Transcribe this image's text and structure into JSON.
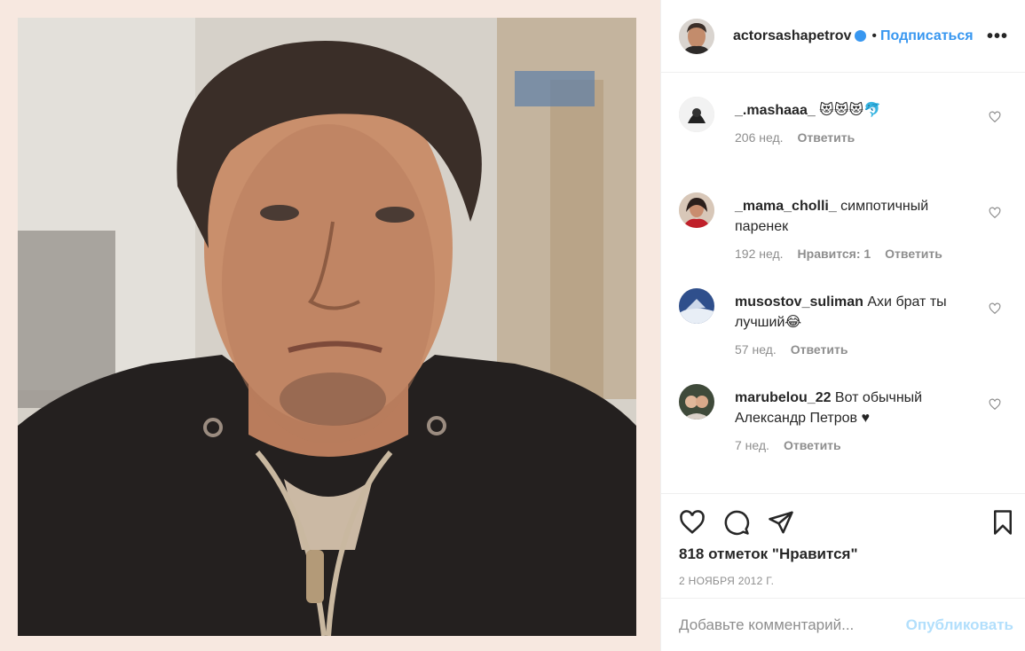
{
  "post": {
    "author": "actorsashapetrov",
    "separator": "•",
    "follow_label": "Подписаться",
    "more_label": "•••"
  },
  "comments": [
    {
      "user": "_.mashaaa_",
      "text": " 😻😻😻🐬",
      "age": "206 нед.",
      "likes": "",
      "reply": "Ответить"
    },
    {
      "user": "_mama_cholli_",
      "text": " симпотичный паренек",
      "age": "192 нед.",
      "likes": "Нравится: 1",
      "reply": "Ответить"
    },
    {
      "user": "musostov_suliman",
      "text": " Ахи брат ты лучший😂",
      "age": "57 нед.",
      "likes": "",
      "reply": "Ответить"
    },
    {
      "user": "marubelou_22",
      "text": " Вот обычный Александр Петров ♥",
      "age": "7 нед.",
      "likes": "",
      "reply": "Ответить"
    }
  ],
  "actions": {
    "likes_count": "818 отметок \"Нравится\"",
    "date": "2 НОЯБРЯ 2012 Г."
  },
  "comment_box": {
    "placeholder": "Добавьте комментарий...",
    "publish_label": "Опубликовать"
  },
  "colors": {
    "accent": "#3897f0",
    "publish_disabled": "#b2dffc",
    "muted": "#8e8e8e",
    "page_background": "#f7e8e0"
  },
  "icons": {
    "verified": "verified-badge-icon",
    "heart": "heart-icon",
    "comment": "comment-icon",
    "share": "paper-plane-icon",
    "save": "bookmark-icon",
    "more": "more-options-icon"
  }
}
